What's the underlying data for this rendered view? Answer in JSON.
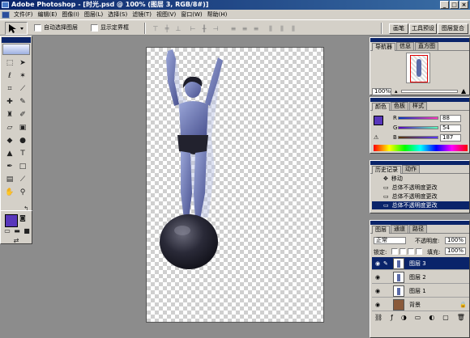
{
  "window": {
    "title": "Adobe Photoshop - [时光.psd @ 100% (图层 3, RGB/8#)]"
  },
  "menu": [
    "文件(F)",
    "编辑(E)",
    "图像(I)",
    "图层(L)",
    "选择(S)",
    "滤镜(T)",
    "视图(V)",
    "窗口(W)",
    "帮助(H)"
  ],
  "options": {
    "auto_select_layer": "自动选择图层",
    "show_bounding_box": "显示定界框",
    "tabs": [
      "画笔",
      "工具预设",
      "图层复合"
    ]
  },
  "navigator": {
    "tabs": [
      "导航器",
      "信息",
      "直方图"
    ],
    "zoom": "100%"
  },
  "color": {
    "tabs": [
      "颜色",
      "色板",
      "样式"
    ],
    "r_label": "R",
    "r_value": "88",
    "g_label": "G",
    "g_value": "54",
    "b_label": "B",
    "b_value": "187",
    "foreground": "#5836bb",
    "background": "#efe6a8"
  },
  "history": {
    "tabs": [
      "历史记录",
      "动作"
    ],
    "items": [
      "移动",
      "总体不透明度更改",
      "总体不透明度更改",
      "总体不透明度更改"
    ]
  },
  "layers": {
    "tabs": [
      "图层",
      "通道",
      "路径"
    ],
    "blend_mode": "正常",
    "opacity_label": "不透明度:",
    "opacity_value": "100%",
    "lock_label": "锁定:",
    "fill_label": "填充:",
    "fill_value": "100%",
    "items": [
      "图层 3",
      "图层 2",
      "图层 1",
      "背景"
    ]
  },
  "colors": {
    "title_bar": "#0a246a",
    "selection": "#0a246a",
    "chrome": "#d4d0c8"
  }
}
